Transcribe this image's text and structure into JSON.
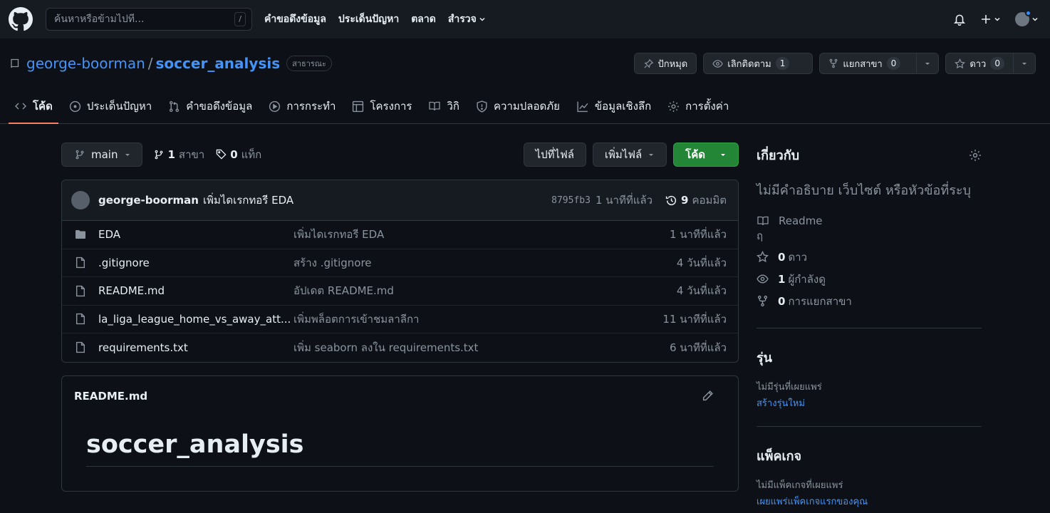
{
  "header": {
    "search_placeholder": "ค้นหาหรือข้ามไปที่...",
    "search_shortcut": "/",
    "nav": [
      "คำขอดึงข้อมูล",
      "ประเด็นปัญหา",
      "ตลาด",
      "สำรวจ"
    ]
  },
  "repo": {
    "owner": "george-boorman",
    "separator": "/",
    "name": "soccer_analysis",
    "visibility": "สาธารณะ",
    "pin_label": "ปักหมุด",
    "watch_label": "เลิกติดตาม",
    "watch_count": "1",
    "fork_label": "แยกสาขา",
    "fork_count": "0",
    "star_label": "ดาว",
    "star_count": "0"
  },
  "tabs": [
    {
      "label": "โค้ด",
      "icon": "code-icon"
    },
    {
      "label": "ประเด็นปัญหา",
      "icon": "issue-icon"
    },
    {
      "label": "คำขอดึงข้อมูล",
      "icon": "pull-request-icon"
    },
    {
      "label": "การกระทำ",
      "icon": "play-icon"
    },
    {
      "label": "โครงการ",
      "icon": "table-icon"
    },
    {
      "label": "วิกิ",
      "icon": "book-icon"
    },
    {
      "label": "ความปลอดภัย",
      "icon": "shield-icon"
    },
    {
      "label": "ข้อมูลเชิงลึก",
      "icon": "graph-icon"
    },
    {
      "label": "การตั้งค่า",
      "icon": "gear-icon"
    }
  ],
  "filebar": {
    "branch": "main",
    "branch_count": "1",
    "branch_label": "สาขา",
    "tag_count": "0",
    "tag_label": "แท็ก",
    "goto_file": "ไปที่ไฟล์",
    "add_file": "เพิ่มไฟล์",
    "code": "โค้ด"
  },
  "commit": {
    "author": "george-boorman",
    "message": "เพิ่มไดเรกทอรี EDA",
    "sha": "8795fb3",
    "time": "1 นาทีที่แล้ว",
    "commit_count": "9",
    "commit_label": "คอมมิต"
  },
  "files": [
    {
      "name": "EDA",
      "type": "folder",
      "message": "เพิ่มไดเรกทอรี EDA",
      "date": "1 นาทีที่แล้ว"
    },
    {
      "name": ".gitignore",
      "type": "file",
      "message": "สร้าง .gitignore",
      "date": "4 วันที่แล้ว"
    },
    {
      "name": "README.md",
      "type": "file",
      "message": "อัปเดต README.md",
      "date": "4 วันที่แล้ว"
    },
    {
      "name": "la_liga_league_home_vs_away_att...",
      "type": "file",
      "message": "เพิ่มพล็อตการเข้าชมลาลีกา",
      "date": "11 นาทีที่แล้ว"
    },
    {
      "name": "requirements.txt",
      "type": "file",
      "message": "เพิ่ม seaborn ลงใน requirements.txt",
      "date": "6 นาทีที่แล้ว"
    }
  ],
  "readme": {
    "filename": "README.md",
    "heading": "soccer_analysis"
  },
  "about": {
    "title": "เกี่ยวกับ",
    "description": "ไม่มีคำอธิบาย เว็บไซต์ หรือหัวข้อที่ระบุ",
    "readme_label": "Readme",
    "readme_sub": "ฤ",
    "stars_count": "0",
    "stars_label": "ดาว",
    "watchers_count": "1",
    "watchers_label": "ผู้กำลังดู",
    "forks_count": "0",
    "forks_label": "การแยกสาขา"
  },
  "releases": {
    "title": "รุ่น",
    "empty": "ไม่มีรุ่นที่เผยแพร่",
    "link": "สร้างรุ่นใหม่"
  },
  "packages": {
    "title": "แพ็คเกจ",
    "empty": "ไม่มีแพ็คเกจที่เผยแพร่",
    "link": "เผยแพร่แพ็คเกจแรกของคุณ"
  },
  "colors": {
    "background": "#0d1117",
    "header": "#161b22",
    "link": "#4493f8",
    "primary_button": "#238636",
    "active_tab_underline": "#f78166"
  }
}
